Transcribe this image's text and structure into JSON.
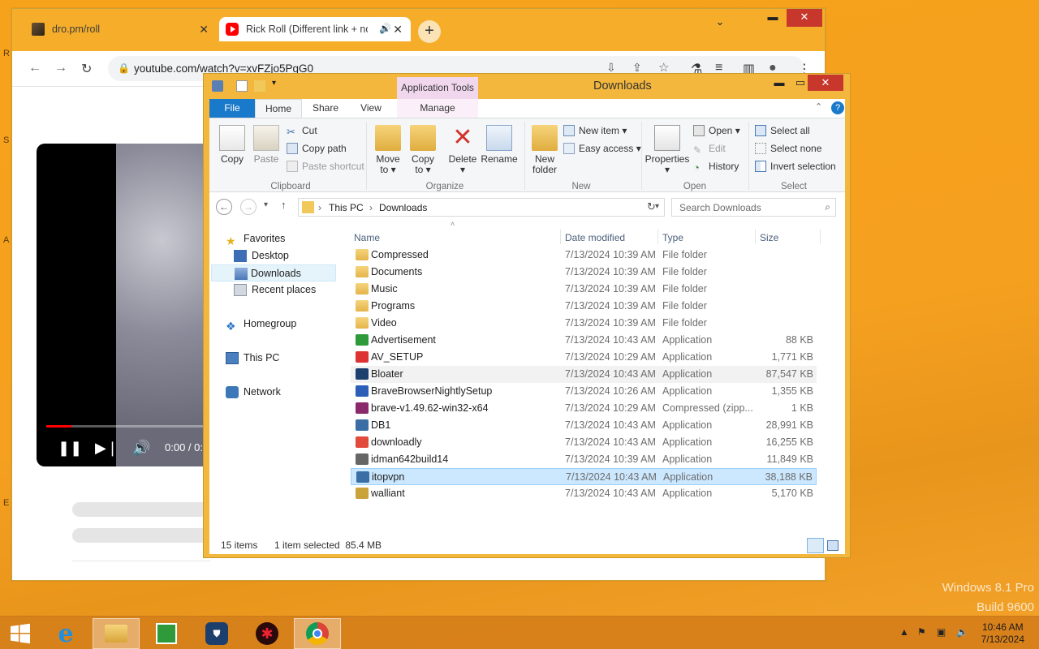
{
  "browser": {
    "tabs": [
      {
        "title": "dro.pm/roll",
        "active": false
      },
      {
        "title": "Rick Roll (Different link + no",
        "active": true
      }
    ],
    "url": "youtube.com/watch?v=xvFZjo5PgG0",
    "video_time": "0:00 / 0:",
    "video_progress_fraction": 0.14
  },
  "explorer": {
    "title": "Downloads",
    "contextual_tab_group": "Application Tools",
    "ribbon_tabs": [
      "File",
      "Home",
      "Share",
      "View",
      "Manage"
    ],
    "ribbon": {
      "clipboard": {
        "copy": "Copy",
        "paste": "Paste",
        "cut": "Cut",
        "copy_path": "Copy path",
        "paste_shortcut": "Paste shortcut",
        "group": "Clipboard"
      },
      "organize": {
        "move_to": "Move",
        "move_to2": "to",
        "copy_to": "Copy",
        "copy_to2": "to",
        "delete": "Delete",
        "rename": "Rename",
        "group": "Organize"
      },
      "new": {
        "new_folder": "New",
        "new_folder2": "folder",
        "new_item": "New item",
        "easy_access": "Easy access",
        "group": "New"
      },
      "open": {
        "properties": "Properties",
        "open": "Open",
        "edit": "Edit",
        "history": "History",
        "group": "Open"
      },
      "select": {
        "select_all": "Select all",
        "select_none": "Select none",
        "invert": "Invert selection",
        "group": "Select"
      }
    },
    "address": {
      "this_pc": "This PC",
      "folder": "Downloads"
    },
    "search_placeholder": "Search Downloads",
    "nav": {
      "favorites": "Favorites",
      "desktop": "Desktop",
      "downloads": "Downloads",
      "recent": "Recent places",
      "homegroup": "Homegroup",
      "this_pc": "This PC",
      "network": "Network"
    },
    "columns": {
      "name": "Name",
      "date": "Date modified",
      "type": "Type",
      "size": "Size"
    },
    "files": [
      {
        "name": "Compressed",
        "date": "7/13/2024 10:39 AM",
        "type": "File folder",
        "size": ""
      },
      {
        "name": "Documents",
        "date": "7/13/2024 10:39 AM",
        "type": "File folder",
        "size": ""
      },
      {
        "name": "Music",
        "date": "7/13/2024 10:39 AM",
        "type": "File folder",
        "size": ""
      },
      {
        "name": "Programs",
        "date": "7/13/2024 10:39 AM",
        "type": "File folder",
        "size": ""
      },
      {
        "name": "Video",
        "date": "7/13/2024 10:39 AM",
        "type": "File folder",
        "size": ""
      },
      {
        "name": "Advertisement",
        "date": "7/13/2024 10:43 AM",
        "type": "Application",
        "size": "88 KB"
      },
      {
        "name": "AV_SETUP",
        "date": "7/13/2024 10:29 AM",
        "type": "Application",
        "size": "1,771 KB"
      },
      {
        "name": "Bloater",
        "date": "7/13/2024 10:43 AM",
        "type": "Application",
        "size": "87,547 KB"
      },
      {
        "name": "BraveBrowserNightlySetup",
        "date": "7/13/2024 10:26 AM",
        "type": "Application",
        "size": "1,355 KB"
      },
      {
        "name": "brave-v1.49.62-win32-x64",
        "date": "7/13/2024 10:29 AM",
        "type": "Compressed (zipp...",
        "size": "1 KB"
      },
      {
        "name": "DB1",
        "date": "7/13/2024 10:43 AM",
        "type": "Application",
        "size": "28,991 KB"
      },
      {
        "name": "downloadly",
        "date": "7/13/2024 10:43 AM",
        "type": "Application",
        "size": "16,255 KB"
      },
      {
        "name": "idman642build14",
        "date": "7/13/2024 10:39 AM",
        "type": "Application",
        "size": "11,849 KB"
      },
      {
        "name": "itopvpn",
        "date": "7/13/2024 10:43 AM",
        "type": "Application",
        "size": "38,188 KB"
      },
      {
        "name": "walliant",
        "date": "7/13/2024 10:43 AM",
        "type": "Application",
        "size": "5,170 KB"
      }
    ],
    "status": {
      "count": "15 items",
      "selection": "1 item selected  85.4 MB"
    }
  },
  "watermark": {
    "line1": "Windows 8.1 Pro",
    "line2": "Build 9600"
  },
  "taskbar": {
    "time": "10:46 AM",
    "date": "7/13/2024"
  },
  "colors": {
    "file_tab": "#1979ca",
    "selected_row": "#cce8ff",
    "close_red": "#c7372b",
    "desktop": "#f7a21b"
  }
}
